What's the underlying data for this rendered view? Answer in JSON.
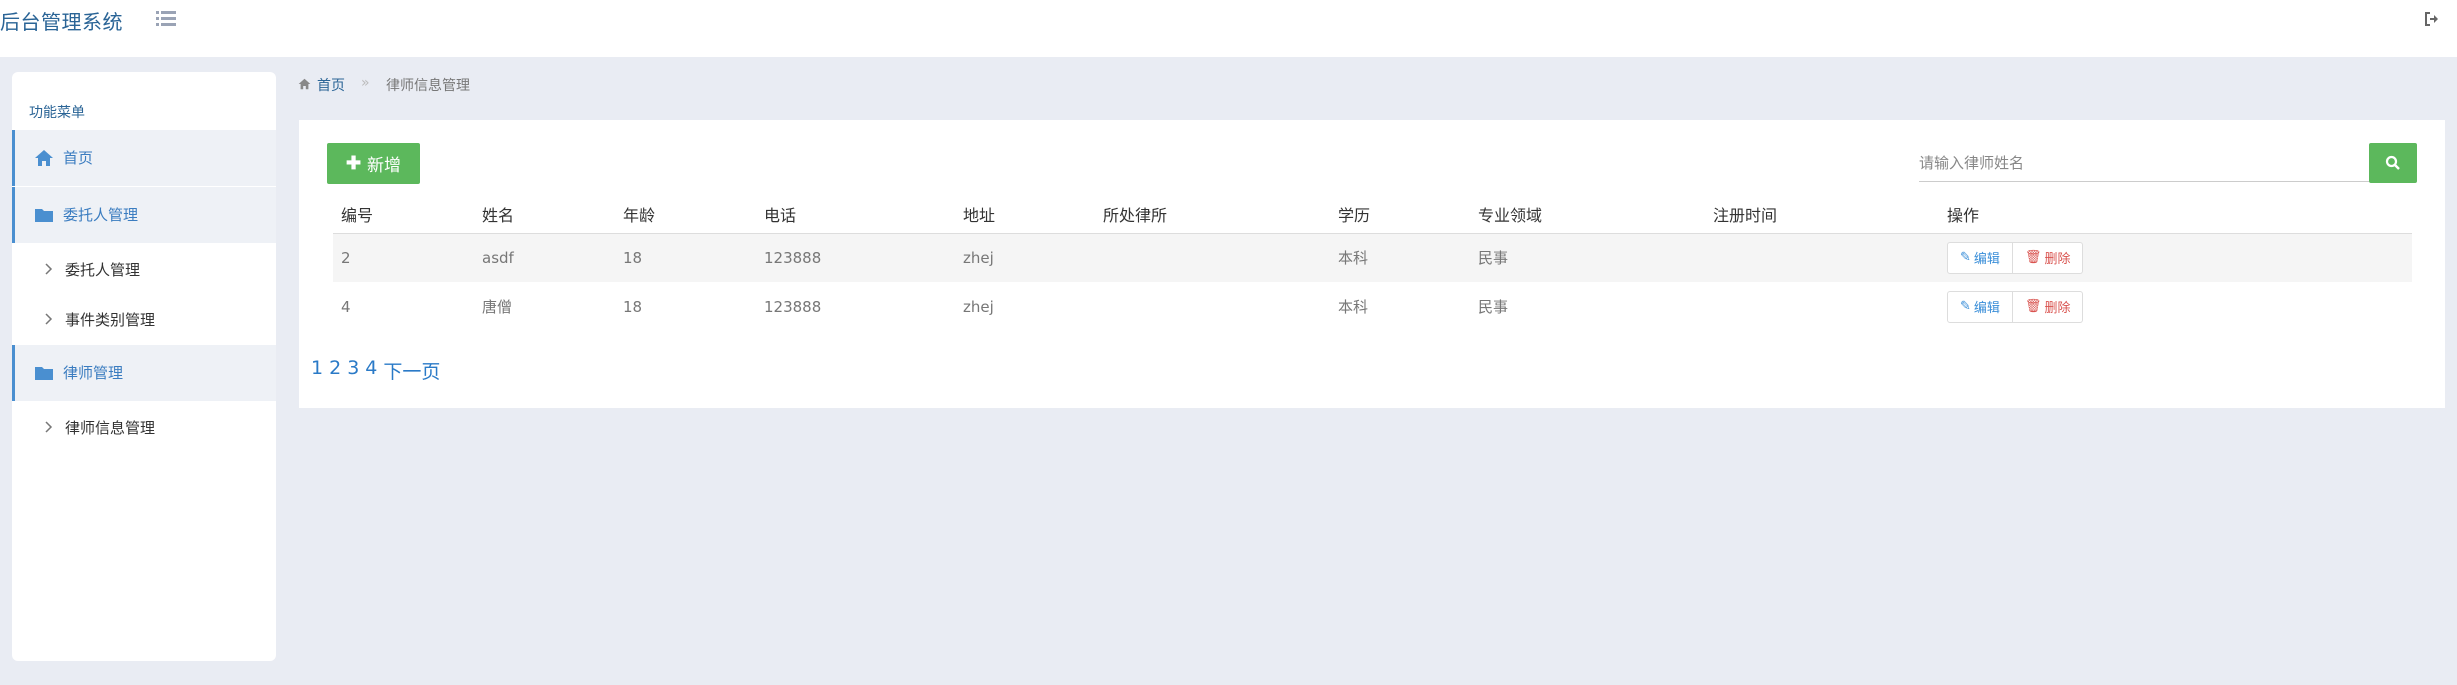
{
  "header": {
    "brand": "后台管理系统"
  },
  "sidebar": {
    "title": "功能菜单",
    "items": [
      {
        "label": "首页",
        "icon": "home-icon",
        "type": "group"
      },
      {
        "label": "委托人管理",
        "icon": "folder-icon",
        "type": "group"
      },
      {
        "label": "委托人管理",
        "icon": "chevron-right-icon",
        "type": "sub"
      },
      {
        "label": "事件类别管理",
        "icon": "chevron-right-icon",
        "type": "sub"
      },
      {
        "label": "律师管理",
        "icon": "folder-icon",
        "type": "group"
      },
      {
        "label": "律师信息管理",
        "icon": "chevron-right-icon",
        "type": "sub"
      }
    ]
  },
  "breadcrumb": {
    "home": "首页",
    "separator": "»",
    "current": "律师信息管理"
  },
  "toolbar": {
    "add_label": "新增",
    "search_placeholder": "请输入律师姓名"
  },
  "table": {
    "columns": [
      "编号",
      "姓名",
      "年龄",
      "电话",
      "地址",
      "所处律所",
      "学历",
      "专业领域",
      "注册时间",
      "操作"
    ],
    "rows": [
      {
        "id": "2",
        "name": "asdf",
        "age": "18",
        "phone": "123888",
        "address": "zhej",
        "firm": "",
        "education": "本科",
        "field": "民事",
        "reg_time": ""
      },
      {
        "id": "4",
        "name": "唐僧",
        "age": "18",
        "phone": "123888",
        "address": "zhej",
        "firm": "",
        "education": "本科",
        "field": "民事",
        "reg_time": ""
      }
    ],
    "edit_label": "编辑",
    "delete_label": "删除"
  },
  "pagination": {
    "pages": [
      "1",
      "2",
      "3",
      "4"
    ],
    "next": "下一页"
  },
  "colors": {
    "accent": "#2a6496",
    "success": "#5cb85c",
    "danger": "#d9534f",
    "background": "#e9ecf3"
  }
}
